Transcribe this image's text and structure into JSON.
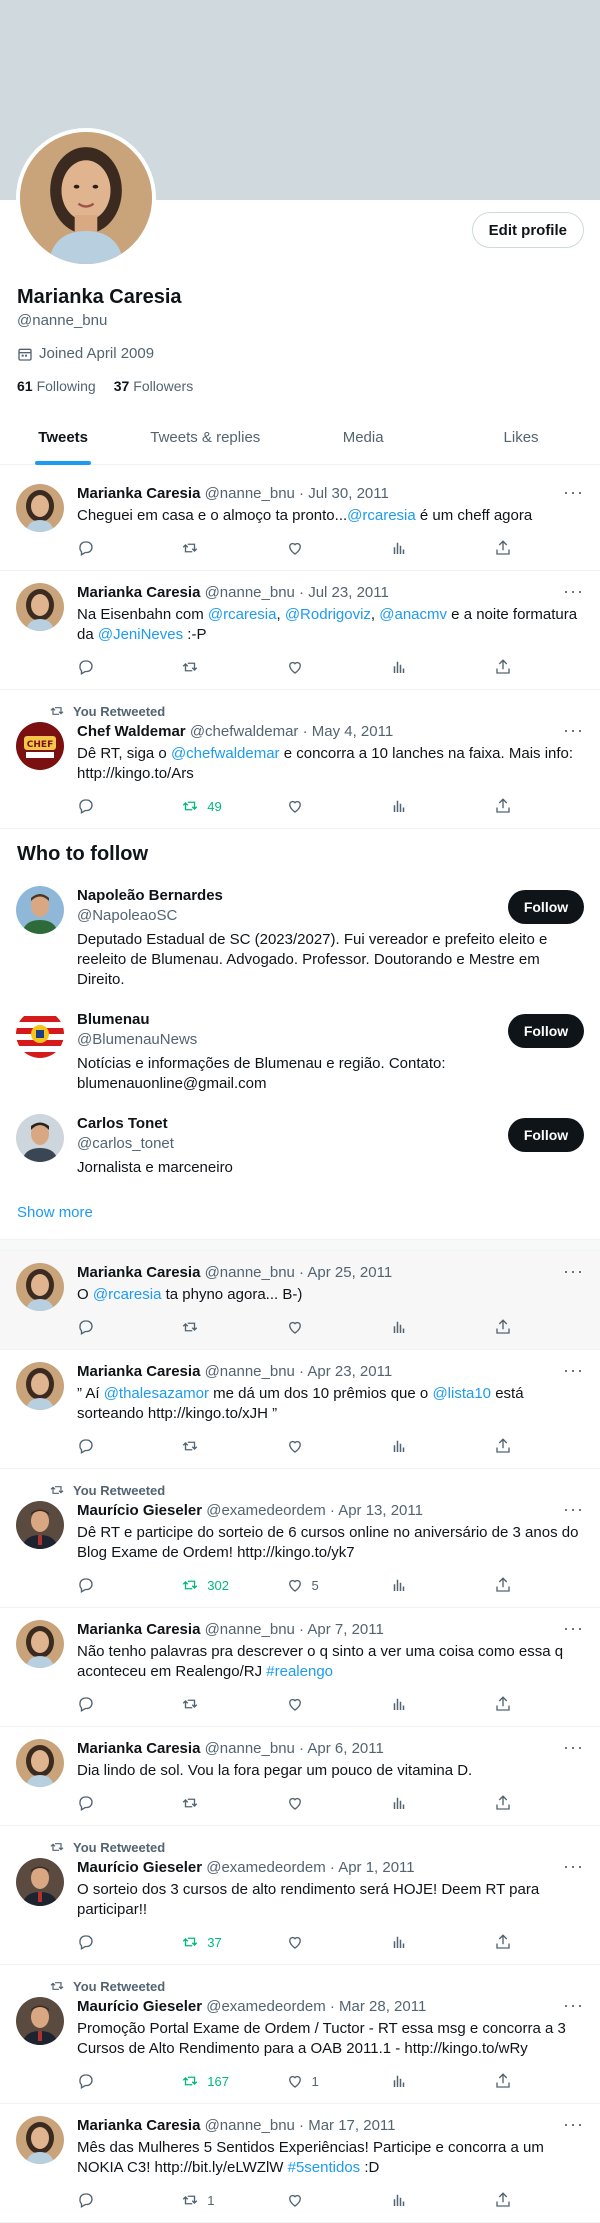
{
  "profile": {
    "name": "Marianka Caresia",
    "handle": "@nanne_bnu",
    "joined": "Joined April 2009",
    "following_count": "61",
    "following_label": "Following",
    "followers_count": "37",
    "followers_label": "Followers",
    "edit_label": "Edit profile"
  },
  "tabs": [
    "Tweets",
    "Tweets & replies",
    "Media",
    "Likes"
  ],
  "retweet_label": "You Retweeted",
  "tweets_a": [
    {
      "name": "Marianka Caresia",
      "meta": "@nanne_bnu · Jul 30, 2011",
      "rt": false,
      "avatar": "woman",
      "text": [
        {
          "t": "Cheguei em casa e o almoço ta pronto..."
        },
        {
          "t": "@rcaresia",
          "l": true
        },
        {
          "t": " é um cheff agora"
        }
      ],
      "rt_count": "",
      "like_count": ""
    },
    {
      "name": "Marianka Caresia",
      "meta": "@nanne_bnu · Jul 23, 2011",
      "rt": false,
      "avatar": "woman",
      "text": [
        {
          "t": "Na Eisenbahn com "
        },
        {
          "t": "@rcaresia",
          "l": true
        },
        {
          "t": ", "
        },
        {
          "t": "@Rodrigoviz",
          "l": true
        },
        {
          "t": ", "
        },
        {
          "t": "@anacmv",
          "l": true
        },
        {
          "t": " e a noite formatura da "
        },
        {
          "t": "@JeniNeves",
          "l": true
        },
        {
          "t": "  :-P"
        }
      ],
      "rt_count": "",
      "like_count": ""
    },
    {
      "name": "Chef Waldemar",
      "meta": "@chefwaldemar · May 4, 2011",
      "rt": true,
      "avatar": "chef",
      "retweeted": true,
      "text": [
        {
          "t": "Dê RT, siga o "
        },
        {
          "t": "@chefwaldemar",
          "l": true
        },
        {
          "t": " e concorra a 10 lanches na faixa. Mais info: http://kingo.to/Ars"
        }
      ],
      "rt_count": "49",
      "like_count": ""
    }
  ],
  "who_to_follow": {
    "title": "Who to follow",
    "follow_label": "Follow",
    "show_more": "Show more",
    "items": [
      {
        "name": "Napoleão Bernardes",
        "handle": "@NapoleaoSC",
        "bio": "Deputado Estadual de SC (2023/2027). Fui vereador e prefeito eleito e reeleito de Blumenau. Advogado. Professor. Doutorando e Mestre em Direito.",
        "avatar": "man1"
      },
      {
        "name": "Blumenau",
        "handle": "@BlumenauNews",
        "bio": "Notícias e informações de Blumenau e região. Contato: blumenauonline@gmail.com",
        "avatar": "flag"
      },
      {
        "name": "Carlos Tonet",
        "handle": "@carlos_tonet",
        "bio": "Jornalista e marceneiro",
        "avatar": "man2"
      }
    ]
  },
  "tweets_b": [
    {
      "name": "Marianka Caresia",
      "meta": "@nanne_bnu · Apr 25, 2011",
      "rt": false,
      "avatar": "woman",
      "highlight": true,
      "text": [
        {
          "t": "O "
        },
        {
          "t": "@rcaresia",
          "l": true
        },
        {
          "t": " ta phyno agora... B-)"
        }
      ],
      "rt_count": "",
      "like_count": ""
    },
    {
      "name": "Marianka Caresia",
      "meta": "@nanne_bnu · Apr 23, 2011",
      "rt": false,
      "avatar": "woman",
      "text": [
        {
          "t": "” Aí "
        },
        {
          "t": "@thalesazamor",
          "l": true
        },
        {
          "t": " me dá um dos 10 prêmios que o "
        },
        {
          "t": "@lista10",
          "l": true
        },
        {
          "t": " está sorteando http://kingo.to/xJH ”"
        }
      ],
      "rt_count": "",
      "like_count": ""
    },
    {
      "name": "Maurício Gieseler",
      "meta": "@examedeordem · Apr 13, 2011",
      "rt": true,
      "avatar": "man3",
      "retweeted": true,
      "text": [
        {
          "t": "Dê RT e participe do sorteio de 6 cursos online no aniversário de 3 anos do Blog Exame de Ordem! http://kingo.to/yk7"
        }
      ],
      "rt_count": "302",
      "like_count": "5"
    },
    {
      "name": "Marianka Caresia",
      "meta": "@nanne_bnu · Apr 7, 2011",
      "rt": false,
      "avatar": "woman",
      "text": [
        {
          "t": "Não tenho palavras pra descrever o q sinto a ver uma coisa como essa q aconteceu em Realengo/RJ "
        },
        {
          "t": "#realengo",
          "l": true
        }
      ],
      "rt_count": "",
      "like_count": ""
    },
    {
      "name": "Marianka Caresia",
      "meta": "@nanne_bnu · Apr 6, 2011",
      "rt": false,
      "avatar": "woman",
      "text": [
        {
          "t": "Dia lindo de sol. Vou la fora pegar um pouco de vitamina D."
        }
      ],
      "rt_count": "",
      "like_count": ""
    },
    {
      "name": "Maurício Gieseler",
      "meta": "@examedeordem · Apr 1, 2011",
      "rt": true,
      "avatar": "man3",
      "retweeted": true,
      "text": [
        {
          "t": "O sorteio dos 3 cursos de alto rendimento será HOJE! Deem RT para participar!!"
        }
      ],
      "rt_count": "37",
      "like_count": ""
    },
    {
      "name": "Maurício Gieseler",
      "meta": "@examedeordem · Mar 28, 2011",
      "rt": true,
      "avatar": "man3",
      "retweeted": true,
      "text": [
        {
          "t": "Promoção Portal Exame de Ordem / Tuctor - RT essa msg e concorra a 3 Cursos de Alto Rendimento para a OAB 2011.1 - http://kingo.to/wRy"
        }
      ],
      "rt_count": "167",
      "like_count": "1"
    },
    {
      "name": "Marianka Caresia",
      "meta": "@nanne_bnu · Mar 17, 2011",
      "rt": false,
      "avatar": "woman",
      "text": [
        {
          "t": "Mês das Mulheres 5 Sentidos Experiências! Participe e concorra a um NOKIA C3! http://bit.ly/eLWZlW "
        },
        {
          "t": "#5sentidos",
          "l": true
        },
        {
          "t": " :D"
        }
      ],
      "rt_count": "1",
      "like_count": ""
    }
  ],
  "colors": {
    "accent": "#1d9bf0",
    "retweet": "#00ba7c",
    "muted": "#536471"
  }
}
